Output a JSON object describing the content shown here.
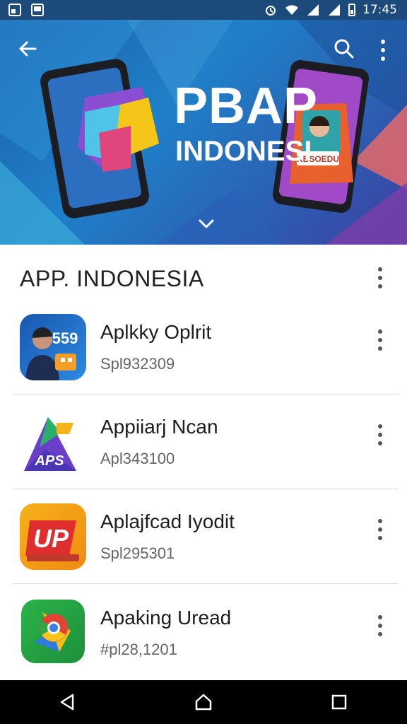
{
  "status_bar": {
    "time": "17:45",
    "icons": [
      "notification-square-icon",
      "gallery-icon",
      "alarm-icon",
      "wifi-icon",
      "signal-icon",
      "signal-icon",
      "battery-icon"
    ]
  },
  "header": {
    "back_icon": "back-arrow-icon",
    "search_icon": "search-icon",
    "overflow_icon": "more-vert-icon",
    "title": "PBAP",
    "subtitle": "INDONESI",
    "phone_screen_label": "KBSOEDU"
  },
  "section": {
    "title": "APP. INDONESIA"
  },
  "apps": [
    {
      "name": "Aplkky Oplrit",
      "sub": "Spl932309",
      "icon": "app-icon-person-badge",
      "badge_text": "559"
    },
    {
      "name": "Appiiarj Ncan",
      "sub": "Apl343100",
      "icon": "app-icon-aps",
      "badge_text": "APS"
    },
    {
      "name": "Aplajfcad Iyodit",
      "sub": "Spl295301",
      "icon": "app-icon-lp",
      "badge_text": "UP"
    },
    {
      "name": "Apaking Uread",
      "sub": "#pl28,1201",
      "icon": "app-icon-chrome-map",
      "badge_text": ""
    }
  ],
  "nav": {
    "back": "nav-back-icon",
    "home": "nav-home-icon",
    "recents": "nav-recents-icon"
  },
  "colors": {
    "hero_blue": "#1f80c9",
    "status_bar": "#1c4a7a",
    "accent_orange": "#f29d1a"
  }
}
